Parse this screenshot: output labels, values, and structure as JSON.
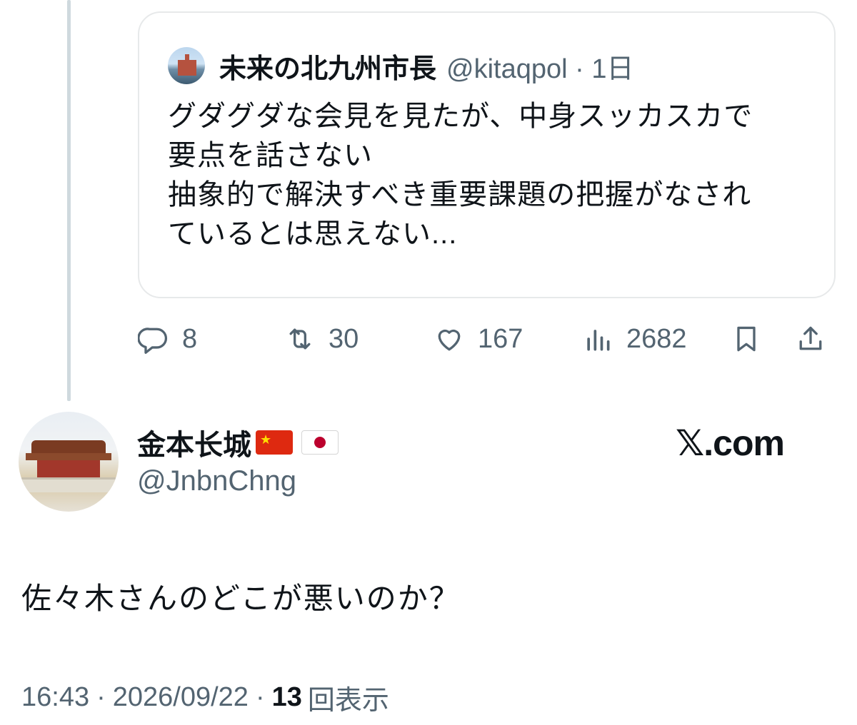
{
  "quoted_post": {
    "author_name": "未来の北九州市長",
    "handle": "@kitaqpol",
    "time": "1日",
    "text_lines": [
      "グダグダな会見を見たが、中身スッカスカで",
      "要点を話さない",
      "抽象的で解決すべき重要課題の把握がなされ",
      "ているとは思えない..."
    ]
  },
  "actions": {
    "replies": "8",
    "reposts": "30",
    "likes": "167",
    "views": "2682"
  },
  "post": {
    "author_name": "金本长城",
    "flags": [
      "cn-flag",
      "jp-flag"
    ],
    "handle": "@JnbnChng",
    "text": "佐々木さんのどこが悪いのか？",
    "time": "16:43",
    "date": "2026/09/22",
    "views_count": "13",
    "views_label": "回表示"
  },
  "brand": "𝕏.com",
  "colors": {
    "text": "#0f1419",
    "secondary": "#536471",
    "border": "#e7e9ea",
    "thread_line": "#cfd9de"
  }
}
